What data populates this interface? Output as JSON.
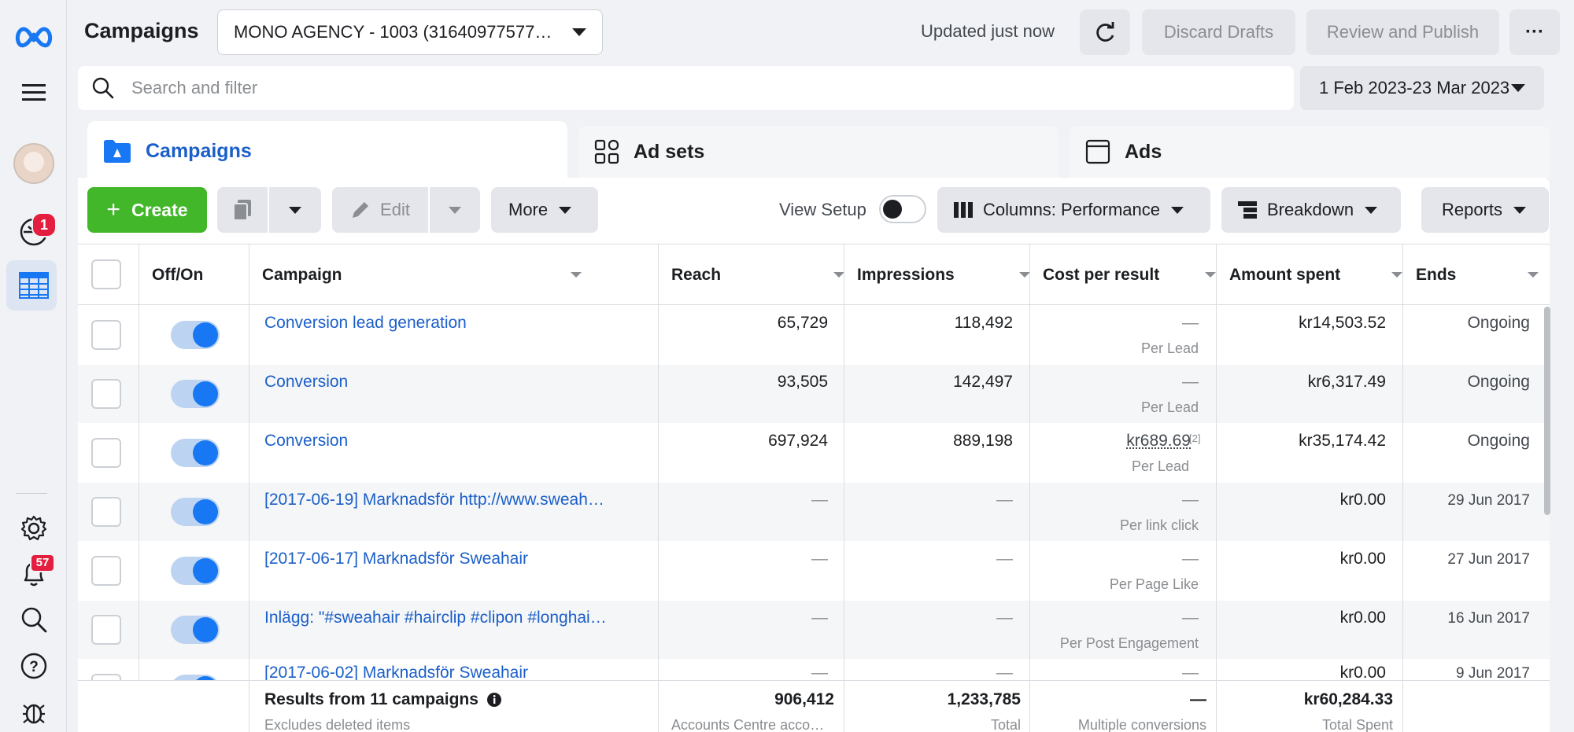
{
  "app": {
    "title": "Campaigns"
  },
  "account": {
    "selected": "MONO AGENCY - 1003 (31640977577…"
  },
  "status": {
    "updated": "Updated just now"
  },
  "actions": {
    "discard": "Discard Drafts",
    "review": "Review and Publish",
    "more": "···"
  },
  "search": {
    "placeholder": "Search and filter",
    "date_range": "1 Feb 2023-23 Mar 2023"
  },
  "rail": {
    "notifications_badge": "1",
    "alerts_badge": "57"
  },
  "tabs": [
    {
      "label": "Campaigns",
      "active": true
    },
    {
      "label": "Ad sets"
    },
    {
      "label": "Ads"
    }
  ],
  "toolbar": {
    "create": "Create",
    "edit": "Edit",
    "more": "More",
    "view_setup": "View Setup",
    "columns": "Columns: Performance",
    "breakdown": "Breakdown",
    "reports": "Reports"
  },
  "table": {
    "columns": [
      "Off/On",
      "Campaign",
      "Reach",
      "Impressions",
      "Cost per result",
      "Amount spent",
      "Ends"
    ],
    "rows": [
      {
        "name": "Conversion lead generation",
        "reach": "65,729",
        "impressions": "118,492",
        "cost": "—",
        "cost_sub": "Per Lead",
        "spent": "kr14,503.52",
        "ends": "Ongoing"
      },
      {
        "name": "Conversion",
        "reach": "93,505",
        "impressions": "142,497",
        "cost": "—",
        "cost_sub": "Per Lead",
        "spent": "kr6,317.49",
        "ends": "Ongoing"
      },
      {
        "name": "Conversion",
        "reach": "697,924",
        "impressions": "889,198",
        "cost": "kr689.69",
        "cost_note": "[2]",
        "cost_sub": "Per Lead",
        "spent": "kr35,174.42",
        "ends": "Ongoing"
      },
      {
        "name": "[2017-06-19] Marknadsför http://www.sweah…",
        "reach": "—",
        "impressions": "—",
        "cost": "—",
        "cost_sub": "Per link click",
        "spent": "kr0.00",
        "ends": "29 Jun 2017"
      },
      {
        "name": "[2017-06-17] Marknadsför Sweahair",
        "reach": "—",
        "impressions": "—",
        "cost": "—",
        "cost_sub": "Per Page Like",
        "spent": "kr0.00",
        "ends": "27 Jun 2017"
      },
      {
        "name": "Inlägg: \"#sweahair #hairclip #clipon #longhai…",
        "reach": "—",
        "impressions": "—",
        "cost": "—",
        "cost_sub": "Per Post Engagement",
        "spent": "kr0.00",
        "ends": "16 Jun 2017"
      },
      {
        "name": "[2017-06-02] Marknadsför Sweahair",
        "reach": "—",
        "impressions": "—",
        "cost": "—",
        "cost_sub": "",
        "spent": "kr0.00",
        "ends": "9 Jun 2017"
      }
    ],
    "footer": {
      "title": "Results from 11 campaigns",
      "subtitle": "Excludes deleted items",
      "reach": "906,412",
      "reach_sub": "Accounts Centre acco…",
      "impressions": "1,233,785",
      "impressions_sub": "Total",
      "cost": "—",
      "cost_sub": "Multiple conversions",
      "spent": "kr60,284.33",
      "spent_sub": "Total Spent"
    }
  },
  "colors": {
    "brand": "#1877f2",
    "create": "#42b72a",
    "link": "#1b5fc9"
  }
}
